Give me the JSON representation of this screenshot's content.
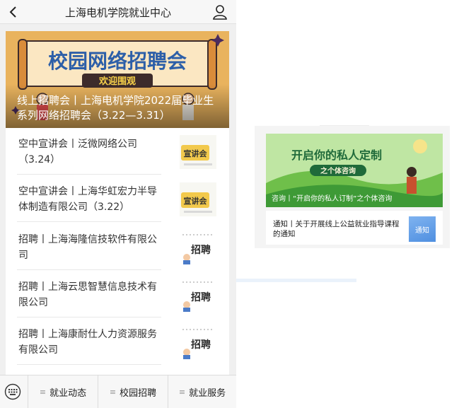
{
  "header": {
    "title": "上海电机学院就业中心"
  },
  "banner": {
    "art_title": "校园网络招聘会",
    "art_subtitle": "欢迎围观",
    "caption": "线上招聘会丨上海电机学院2022届毕业生系列网络招聘会（3.22—3.31）"
  },
  "list": [
    {
      "title": "空中宣讲会丨泛微网络公司（3.24）",
      "thumb": "宣讲会"
    },
    {
      "title": "空中宣讲会丨上海华虹宏力半导体制造有限公司（3.22）",
      "thumb": "宣讲会"
    },
    {
      "title": "招聘丨上海海隆信技软件有限公司",
      "thumb": "招聘"
    },
    {
      "title": "招聘丨上海云思智慧信息技术有限公司",
      "thumb": "招聘"
    },
    {
      "title": "招聘丨上海康耐仕人力资源服务有限公司",
      "thumb": "招聘"
    }
  ],
  "bottom_menu": {
    "tabs": [
      "就业动态",
      "校园招聘",
      "就业服务"
    ]
  },
  "right_card": {
    "image_title": "开启你的私人定制",
    "image_subtitle": "之个体咨询",
    "image_caption": "咨询丨“开启你的私人订制”之个体咨询",
    "notice_text": "通知丨关于开展线上公益就业指导课程的通知",
    "notice_thumb": "通知"
  },
  "colors": {
    "banner_bg": "#e9b35e",
    "scroll_bg": "#2e6fbe",
    "thumb_yellow": "#f2c94c"
  }
}
